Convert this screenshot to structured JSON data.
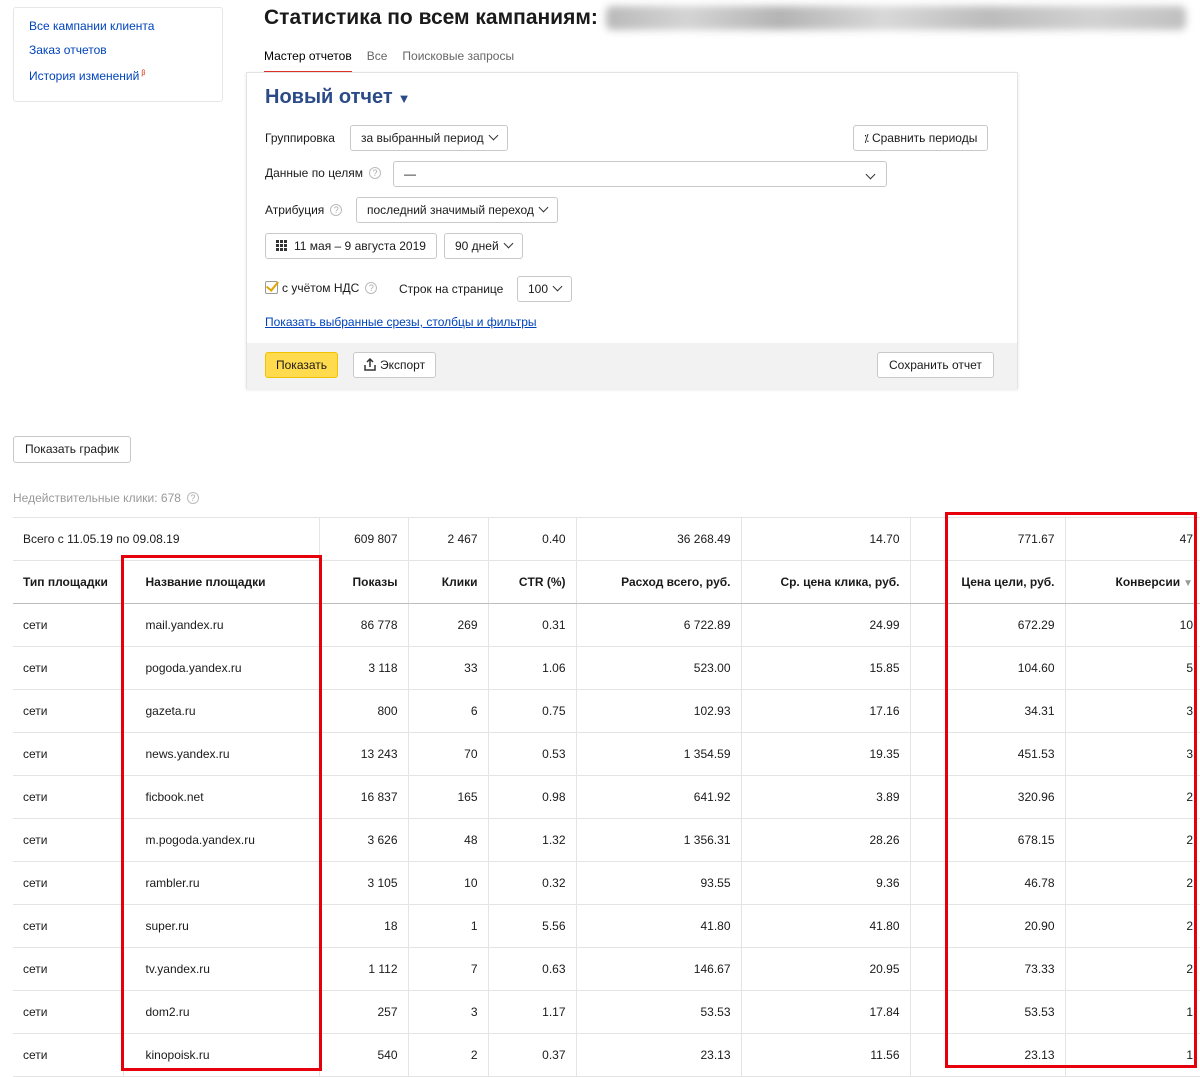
{
  "leftnav": {
    "items": [
      "Все кампании клиента",
      "Заказ отчетов",
      "История изменений"
    ],
    "beta": "β"
  },
  "header": {
    "title": "Статистика по всем кампаниям:"
  },
  "tabs": [
    "Мастер отчетов",
    "Все",
    "Поисковые запросы"
  ],
  "report": {
    "name": "Новый отчет",
    "grouping_label": "Группировка",
    "grouping_value": "за выбранный период",
    "compare_button": "Сравнить периоды",
    "goals_label": "Данные по целям",
    "goals_value": "—",
    "attribution_label": "Атрибуция",
    "attribution_value": "последний значимый переход",
    "date_range": "11 мая – 9 августа 2019",
    "period": "90 дней",
    "vat_label": "с учётом НДС",
    "rows_label": "Строк на странице",
    "rows_value": "100",
    "show_filters_link": "Показать выбранные срезы, столбцы и фильтры",
    "show_button": "Показать",
    "export_button": "Экспорт",
    "save_button": "Сохранить отчет"
  },
  "show_chart_button": "Показать график",
  "invalid_clicks": "Недействительные клики: 678",
  "table": {
    "total_label": "Всего с 11.05.19 по 09.08.19",
    "totals": [
      "609 807",
      "2 467",
      "0.40",
      "36 268.49",
      "14.70",
      "771.67",
      "47"
    ],
    "headers": [
      "Тип площадки",
      "Название площадки",
      "Показы",
      "Клики",
      "CTR (%)",
      "Расход всего, руб.",
      "Ср. цена клика, руб.",
      "Цена цели, руб.",
      "Конверсии"
    ],
    "sort_indicator": "▼",
    "rows": [
      [
        "сети",
        "mail.yandex.ru",
        "86 778",
        "269",
        "0.31",
        "6 722.89",
        "24.99",
        "672.29",
        "10"
      ],
      [
        "сети",
        "pogoda.yandex.ru",
        "3 118",
        "33",
        "1.06",
        "523.00",
        "15.85",
        "104.60",
        "5"
      ],
      [
        "сети",
        "gazeta.ru",
        "800",
        "6",
        "0.75",
        "102.93",
        "17.16",
        "34.31",
        "3"
      ],
      [
        "сети",
        "news.yandex.ru",
        "13 243",
        "70",
        "0.53",
        "1 354.59",
        "19.35",
        "451.53",
        "3"
      ],
      [
        "сети",
        "ficbook.net",
        "16 837",
        "165",
        "0.98",
        "641.92",
        "3.89",
        "320.96",
        "2"
      ],
      [
        "сети",
        "m.pogoda.yandex.ru",
        "3 626",
        "48",
        "1.32",
        "1 356.31",
        "28.26",
        "678.15",
        "2"
      ],
      [
        "сети",
        "rambler.ru",
        "3 105",
        "10",
        "0.32",
        "93.55",
        "9.36",
        "46.78",
        "2"
      ],
      [
        "сети",
        "super.ru",
        "18",
        "1",
        "5.56",
        "41.80",
        "41.80",
        "20.90",
        "2"
      ],
      [
        "сети",
        "tv.yandex.ru",
        "1 112",
        "7",
        "0.63",
        "146.67",
        "20.95",
        "73.33",
        "2"
      ],
      [
        "сети",
        "dom2.ru",
        "257",
        "3",
        "1.17",
        "53.53",
        "17.84",
        "53.53",
        "1"
      ],
      [
        "сети",
        "kinopoisk.ru",
        "540",
        "2",
        "0.37",
        "23.13",
        "11.56",
        "23.13",
        "1"
      ]
    ]
  },
  "colors": {
    "accent_yellow": "#ffdb4d",
    "link_blue": "#0044bb",
    "highlight_red": "#e5000b",
    "tab_underline": "#e2312a"
  }
}
